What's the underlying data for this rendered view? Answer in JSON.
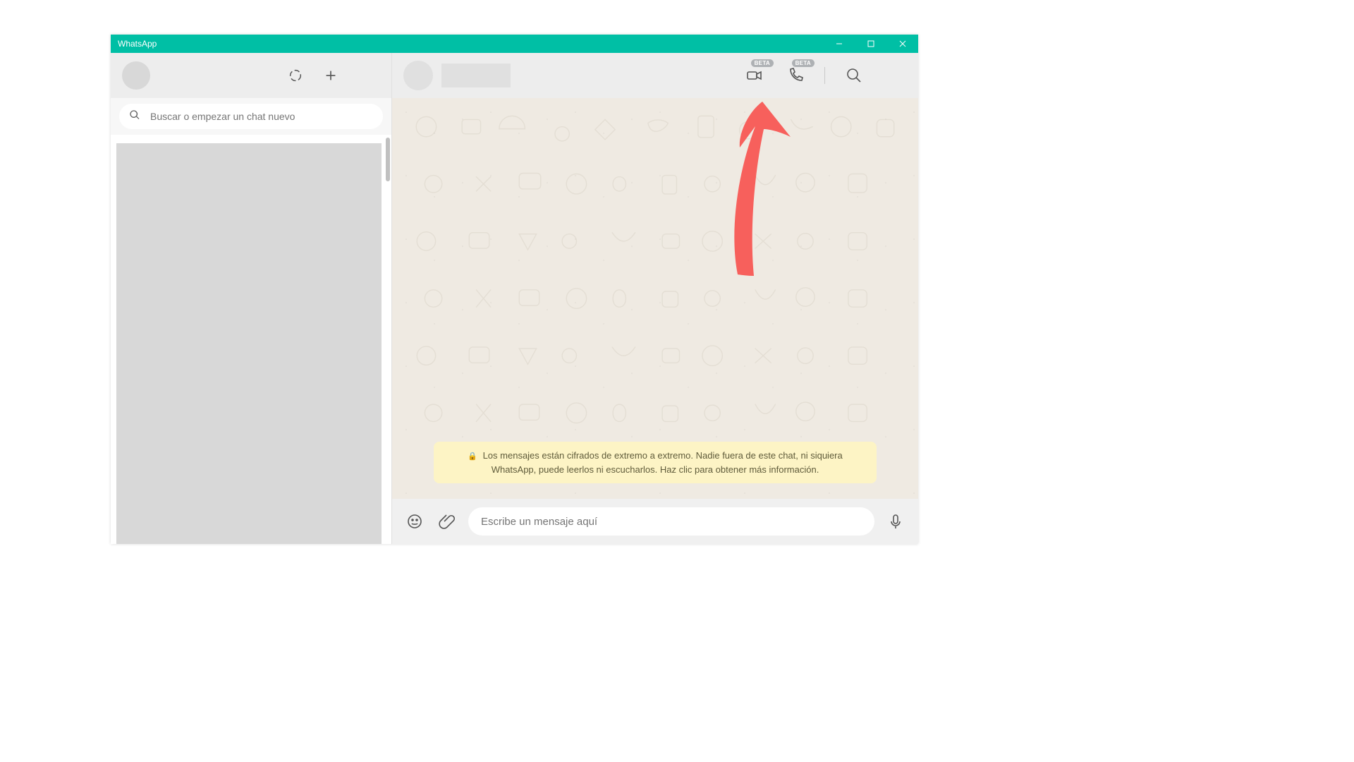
{
  "window": {
    "title": "WhatsApp"
  },
  "left": {
    "search_placeholder": "Buscar o empezar un chat nuevo"
  },
  "chat": {
    "beta_label": "BETA",
    "encryption_notice": "Los mensajes están cifrados de extremo a extremo. Nadie fuera de este chat, ni siquiera WhatsApp, puede leerlos ni escucharlos. Haz clic para obtener más información."
  },
  "composer": {
    "placeholder": "Escribe un mensaje aquí"
  },
  "colors": {
    "accent": "#00bfa5",
    "banner_bg": "#fdf4c5",
    "chat_bg": "#efeae2",
    "annotation": "#f7605c"
  }
}
